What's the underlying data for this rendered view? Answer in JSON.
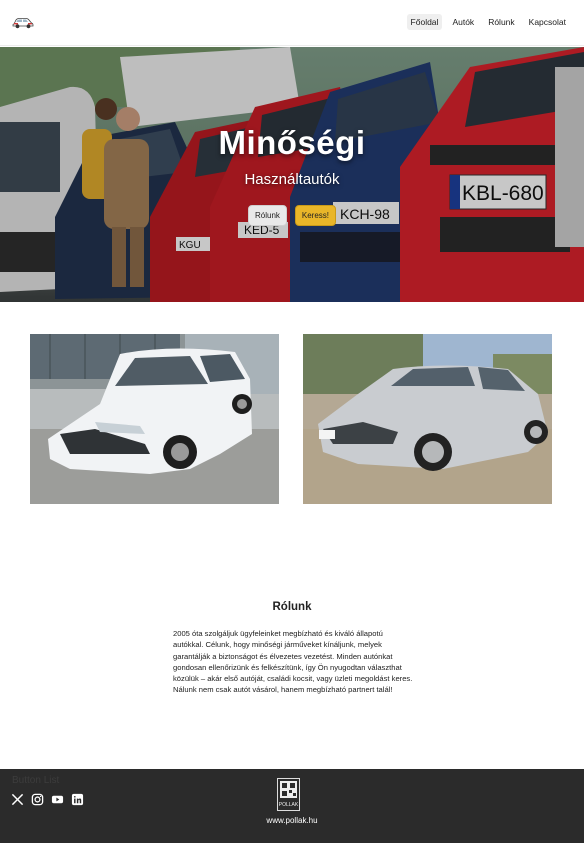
{
  "header": {
    "logo_icon": "car-logo-icon",
    "nav": [
      {
        "label": "Főoldal",
        "active": true
      },
      {
        "label": "Autók",
        "active": false
      },
      {
        "label": "Rólunk",
        "active": false
      },
      {
        "label": "Kapcsolat",
        "active": false
      }
    ]
  },
  "hero": {
    "title": "Minőségi",
    "subtitle": "Használtautók",
    "primary_button": "Rólunk",
    "secondary_button": "Keress!",
    "accent_color": "#e9b629",
    "plates": [
      "KBL-680",
      "KCH-98",
      "KED-5",
      "KGU"
    ]
  },
  "cars": [
    {
      "image": "white Ford Focus estate"
    },
    {
      "image": "silver Peugeot 308 hatchback"
    }
  ],
  "about": {
    "title": "Rólunk",
    "text": "2005 óta szolgáljuk ügyfeleinket megbízható és kiváló állapotú autókkal. Célunk, hogy minőségi járműveket kínáljunk, melyek garantálják a biztonságot és élvezetes vezetést. Minden autónkat gondosan ellenőrizünk és felkészítünk, így Ön nyugodtan választhat közülük – akár első autóját, családi kocsit, vagy üzleti megoldást keres. Nálunk nem csak autót vásárol, hanem megbízható partnert talál!"
  },
  "footer": {
    "ghost_text": "Button List",
    "socials": [
      "x-icon",
      "instagram-icon",
      "youtube-icon",
      "linkedin-icon"
    ],
    "logo_text": "POLLAK",
    "url": "www.pollak.hu",
    "background": "#2b2b2b"
  }
}
